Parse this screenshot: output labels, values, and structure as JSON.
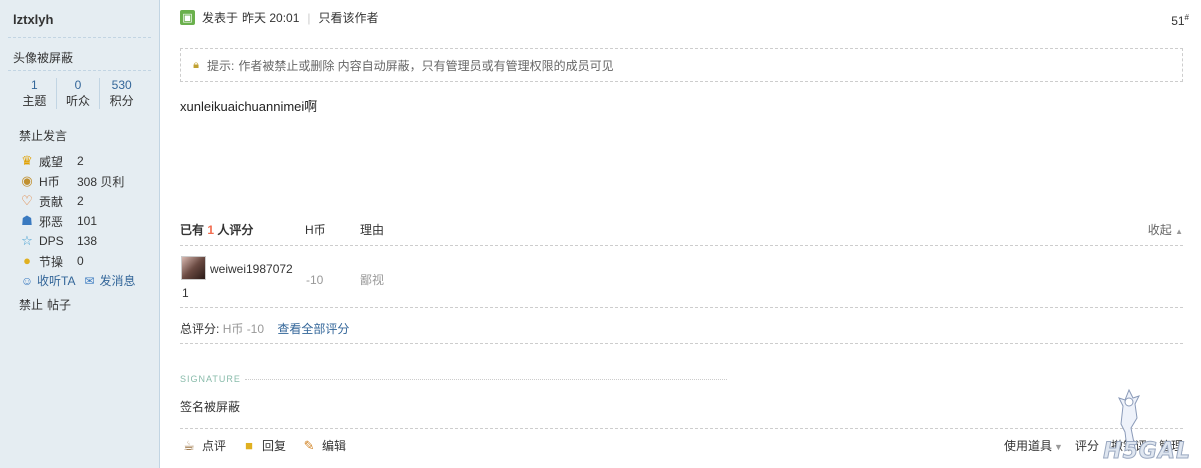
{
  "sidebar": {
    "username": "lztxlyh",
    "avatar_blocked": "头像被屏蔽",
    "stats": [
      {
        "num": "1",
        "label": "主题"
      },
      {
        "num": "0",
        "label": "听众"
      },
      {
        "num": "530",
        "label": "积分"
      }
    ],
    "status": "禁止发言",
    "attributes": [
      {
        "icon": "crown-icon",
        "name": "威望",
        "value": "2"
      },
      {
        "icon": "coin-icon",
        "name": "H币",
        "value": "308 贝利"
      },
      {
        "icon": "heart-icon",
        "name": "贡献",
        "value": "2"
      },
      {
        "icon": "evil-icon",
        "name": "邪恶",
        "value": "101"
      },
      {
        "icon": "star-icon",
        "name": "DPS",
        "value": "138"
      },
      {
        "icon": "bulb-icon",
        "name": "节操",
        "value": "0"
      }
    ],
    "follow_label": "收听TA",
    "message_label": "发消息",
    "ban_label": "禁止",
    "posts_label": "帖子"
  },
  "post": {
    "posted_prefix": "发表于",
    "posted_time": "昨天 20:01",
    "only_author": "只看该作者",
    "floor_num": "51",
    "floor_sup": "#",
    "notice_label": "提示:",
    "notice_text": "作者被禁止或删除 内容自动屏蔽，只有管理员或有管理权限的成员可见",
    "content": "xunleikuaichuannimei啊"
  },
  "rating": {
    "title_prefix": "已有",
    "count": "1",
    "title_suffix": "人评分",
    "col_currency": "H币",
    "col_reason": "理由",
    "collapse": "收起",
    "rows": [
      {
        "user_line1": "weiwei1987072",
        "user_line2": "1",
        "value": "-10",
        "reason": "鄙视"
      }
    ],
    "total_label": "总评分:",
    "total_value": "H币 -10",
    "view_all": "查看全部评分"
  },
  "signature": {
    "label": "SIGNATURE",
    "text": "签名被屏蔽"
  },
  "footer": {
    "comment": "点评",
    "reply": "回复",
    "edit": "编辑",
    "use_item": "使用道具",
    "rate": "评分",
    "revoke": "撤销评",
    "manage": "管理"
  },
  "watermark": {
    "text": "H5GAL"
  }
}
